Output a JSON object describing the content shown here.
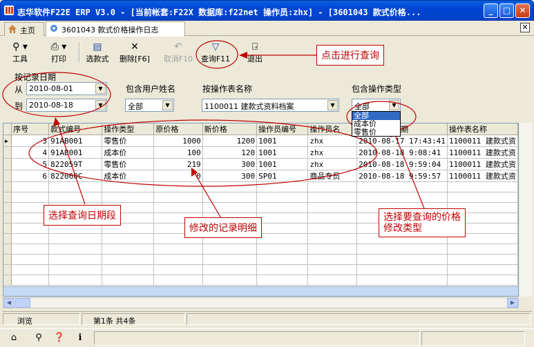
{
  "window": {
    "title": "志华软件F22E ERP V3.0  - [当前帐套:F22X 数据库:f22net 操作员:zhx] - [3601043 款式价格...",
    "min": "_",
    "max": "□",
    "close": "✕"
  },
  "tabs": [
    {
      "label": "主页"
    },
    {
      "label": "3601043 款式价格操作日志"
    }
  ],
  "tab_close": "✕",
  "toolbar": {
    "tools": "工具",
    "print": "打印",
    "select_style": "选款式",
    "delete": "删除[F6]",
    "cancel": "取消F10",
    "query": "查询F11",
    "exit": "退出"
  },
  "filters": {
    "date_group_label": "按记录日期",
    "from_label": "从",
    "from_value": "2010-08-01",
    "to_label": "到",
    "to_value": "2010-08-18",
    "user_label": "包含用户姓名",
    "user_value": "全部",
    "table_label": "按操作表名称",
    "table_value": "1100011 建款式资料档案",
    "optype_label": "包含操作类型",
    "optype_value": "全部",
    "optype_options": [
      "全部",
      "成本价",
      "零售价"
    ]
  },
  "grid": {
    "columns": [
      "序号",
      "款式编号",
      "操作类型",
      "原价格",
      "新价格",
      "操作员编号",
      "操作员名",
      "日期",
      "操作表名称"
    ],
    "rows": [
      [
        "3",
        "91AB001",
        "零售价",
        "1000",
        "1200",
        "1001",
        "zhx",
        "2010-08-17 17:43:41",
        "1100011 建款式资"
      ],
      [
        "4",
        "91AB001",
        "成本价",
        "100",
        "120",
        "1001",
        "zhx",
        "2010-08-18 9:08:41",
        "1100011 建款式资"
      ],
      [
        "5",
        "822059T",
        "零售价",
        "219",
        "300",
        "1001",
        "zhx",
        "2010-08-18 9:59:04",
        "1100011 建款式资"
      ],
      [
        "6",
        "822060C",
        "成本价",
        "0",
        "300",
        "SP01",
        "商品专员",
        "2010-08-18 9:59:57",
        "1100011 建款式资"
      ]
    ]
  },
  "status": {
    "mode": "浏览",
    "record": "第1条 共4条"
  },
  "annotations": {
    "query": "点击进行查询",
    "date": "选择查询日期段",
    "detail": "修改的记录明细",
    "type_line1": "选择要查询的价格",
    "type_line2": "修改类型"
  },
  "colors": {
    "annotation": "#c00000",
    "titlebar": "#0046d5",
    "selection": "#316ac5"
  }
}
